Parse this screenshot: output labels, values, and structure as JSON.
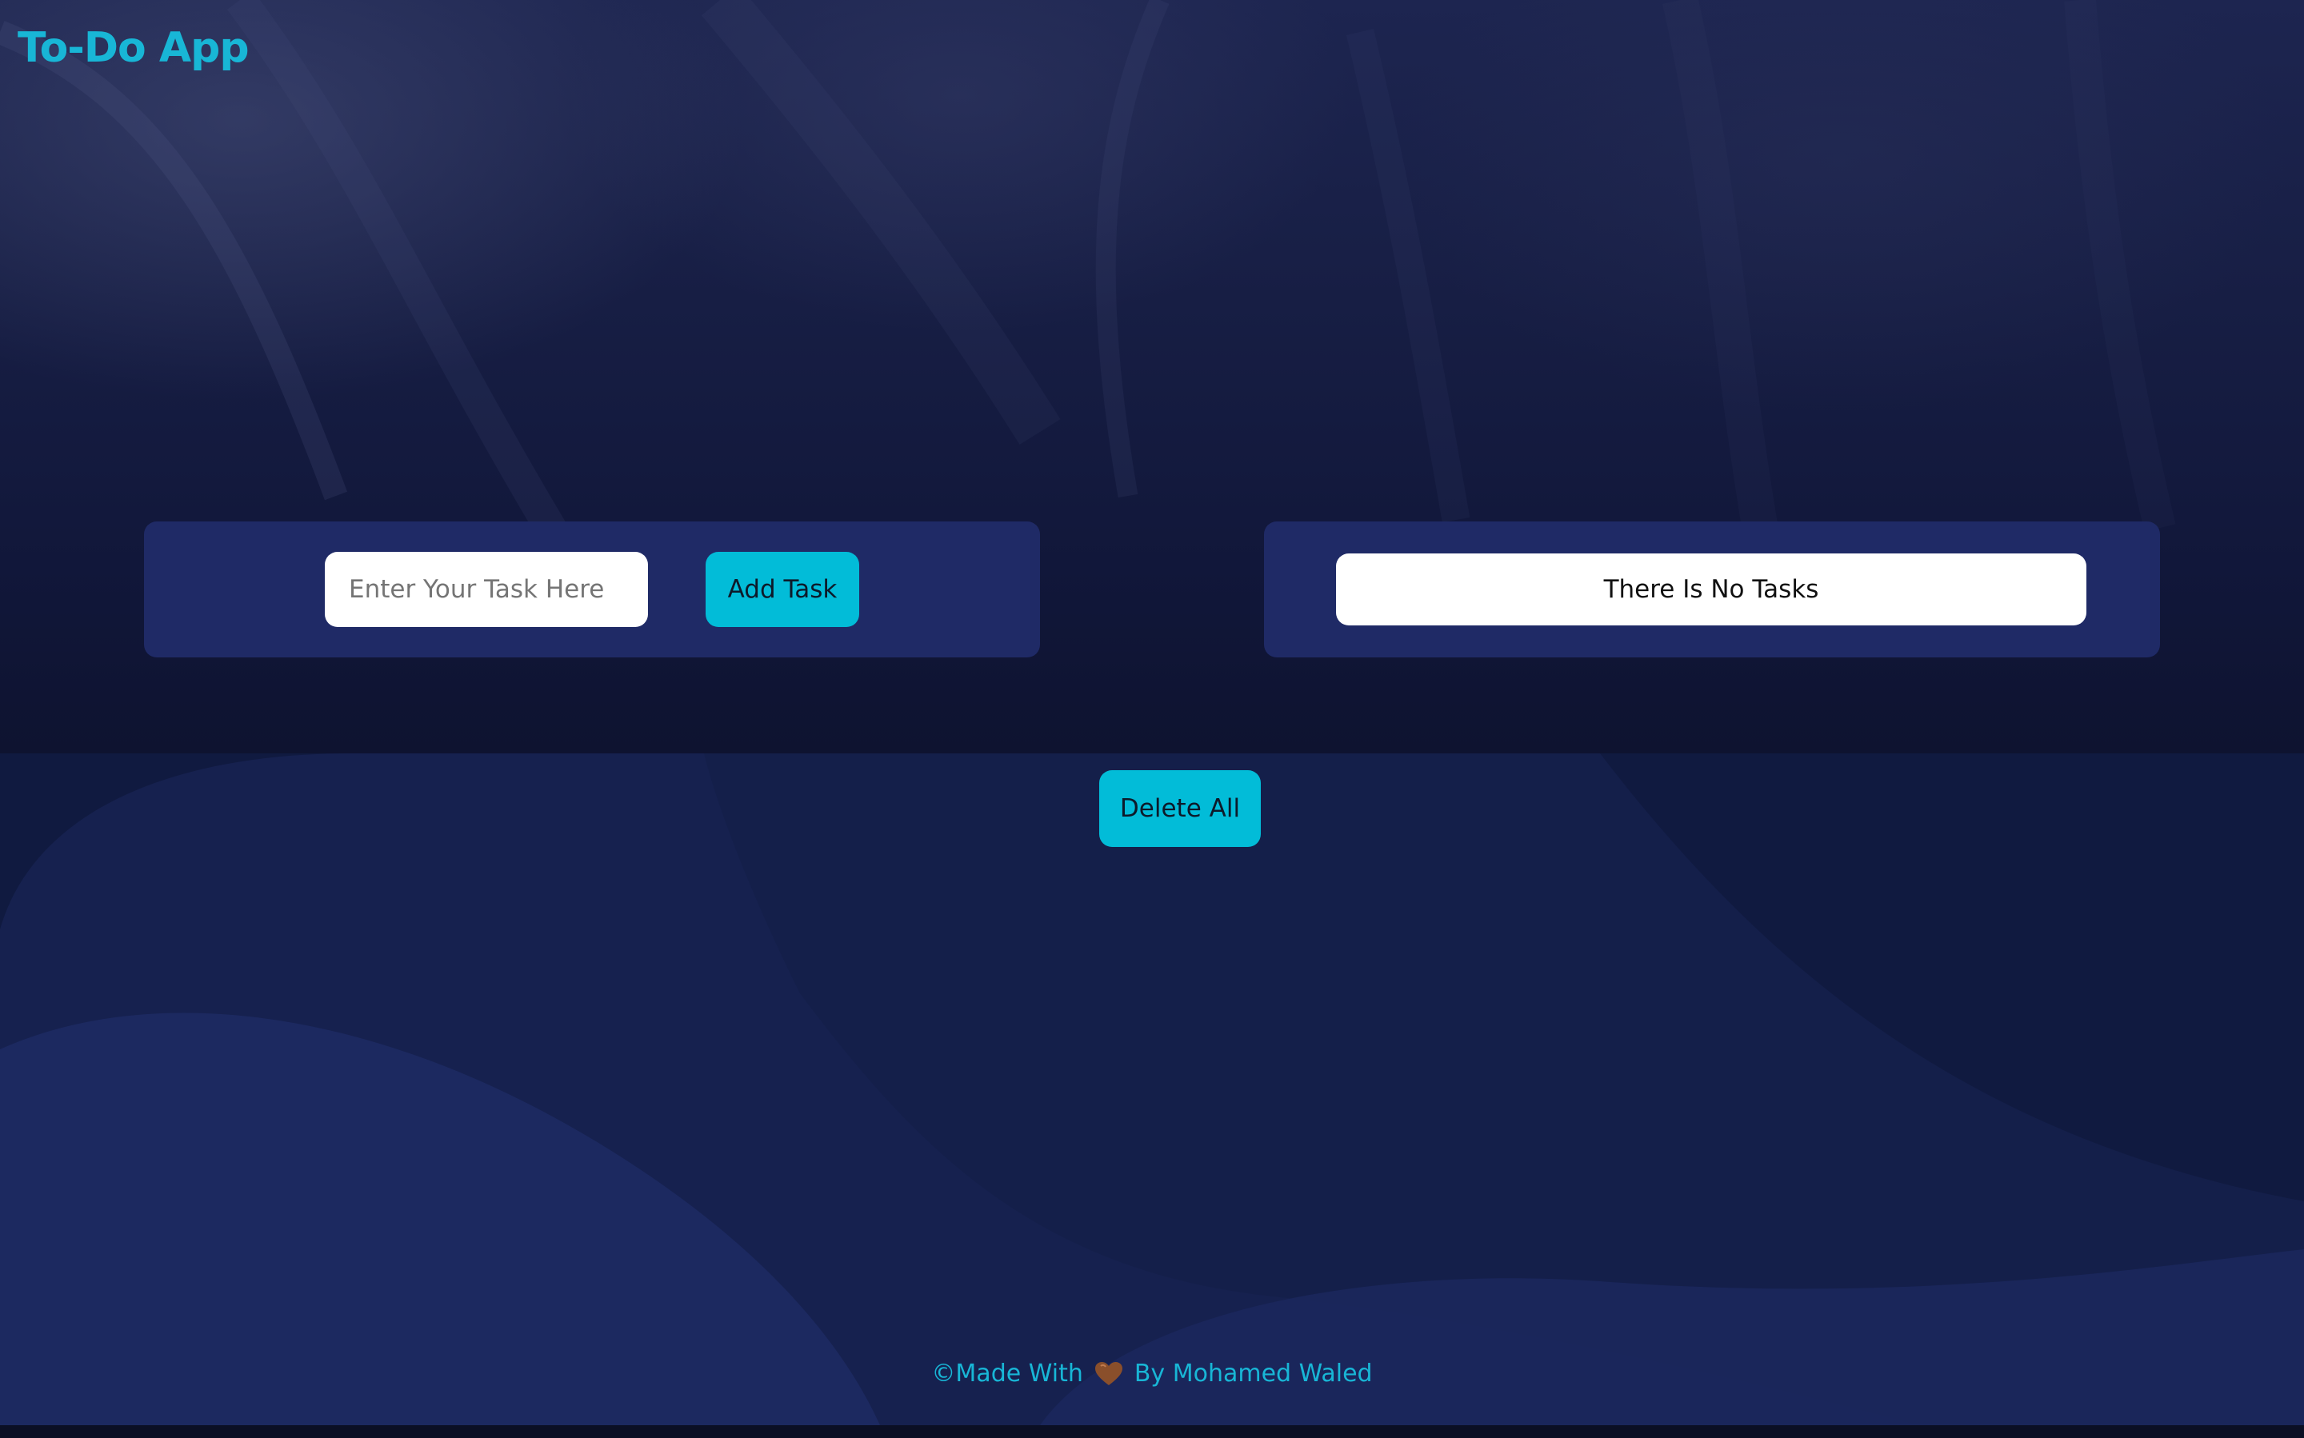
{
  "header": {
    "title": "To-Do App"
  },
  "task_form": {
    "input_value": "",
    "input_placeholder": "Enter Your Task Here",
    "add_label": "Add Task"
  },
  "tasks": {
    "empty_message": "There Is No Tasks"
  },
  "actions": {
    "delete_all_label": "Delete All"
  },
  "footer": {
    "prefix": "©Made With",
    "icon": "heart-icon",
    "suffix": "By Mohamed Waled"
  },
  "colors": {
    "accent": "#02bcd8",
    "title": "#18b6d6",
    "panel": "#1f2a66",
    "background": "#0f1431",
    "heart": "#8a4f2b"
  }
}
